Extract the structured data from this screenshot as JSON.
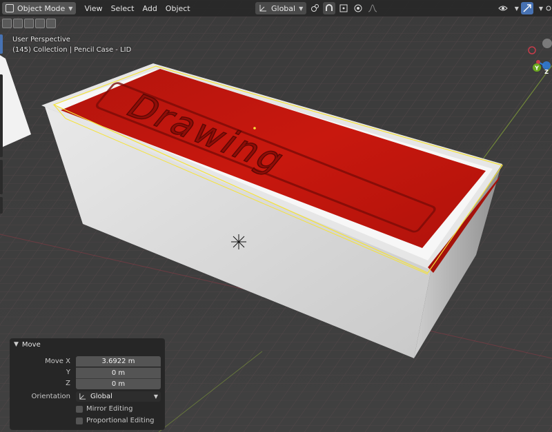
{
  "header": {
    "mode_label": "Object Mode",
    "menus": [
      "View",
      "Select",
      "Add",
      "Object"
    ],
    "transform_orientation": "Global"
  },
  "overlay": {
    "view_name": "User Perspective",
    "collection_info": "(145) Collection | Pencil Case - LID"
  },
  "gizmo": {
    "axes": [
      "Y",
      "Z"
    ],
    "colors": {
      "x": "#c83c4b",
      "y": "#6ba71f",
      "z": "#2f7ddc"
    }
  },
  "scene": {
    "lid_text": "Drawing",
    "lid_color": "#c0140c",
    "box_color": "#d8d8d8",
    "selection_outline": "#f5e33a"
  },
  "operator_panel": {
    "title": "Move",
    "move_x_label": "Move X",
    "move_x": "3.6922 m",
    "y_label": "Y",
    "y": "0 m",
    "z_label": "Z",
    "z": "0 m",
    "orientation_label": "Orientation",
    "orientation": "Global",
    "mirror_editing": "Mirror Editing",
    "proportional_editing": "Proportional Editing"
  }
}
